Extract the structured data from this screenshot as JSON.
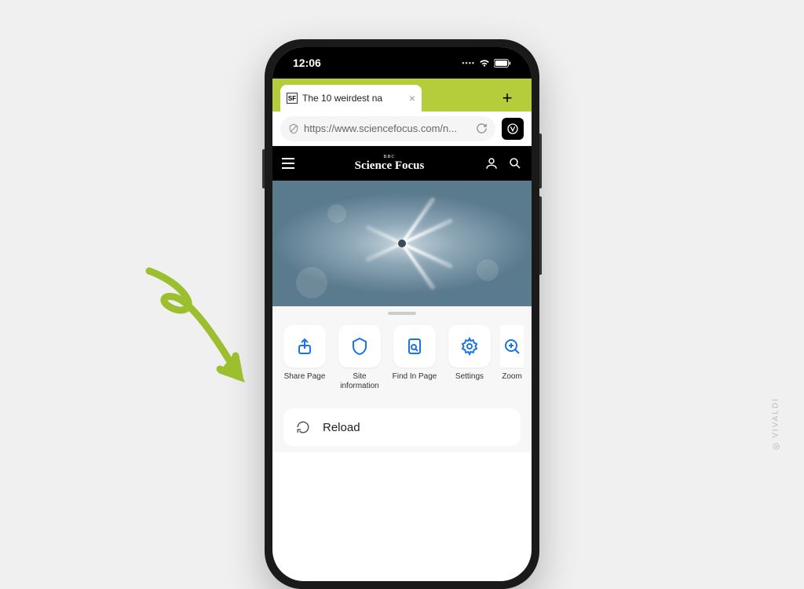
{
  "status": {
    "time": "12:06"
  },
  "tabs": [
    {
      "favicon": "SF",
      "title": "The 10 weirdest na"
    }
  ],
  "address": {
    "url": "https://www.sciencefocus.com/n..."
  },
  "site": {
    "supertitle": "BBC",
    "title": "Science Focus"
  },
  "actions": [
    {
      "label": "Share Page",
      "icon": "share"
    },
    {
      "label": "Site information",
      "icon": "shield"
    },
    {
      "label": "Find In Page",
      "icon": "find"
    },
    {
      "label": "Settings",
      "icon": "gear"
    },
    {
      "label": "Zoom",
      "icon": "zoom"
    }
  ],
  "menu": {
    "reload": "Reload"
  },
  "watermark": "VIVALDI",
  "colors": {
    "accent": "#b5cc3b",
    "action_icon": "#1a73e8",
    "arrow": "#9cbf2f"
  }
}
